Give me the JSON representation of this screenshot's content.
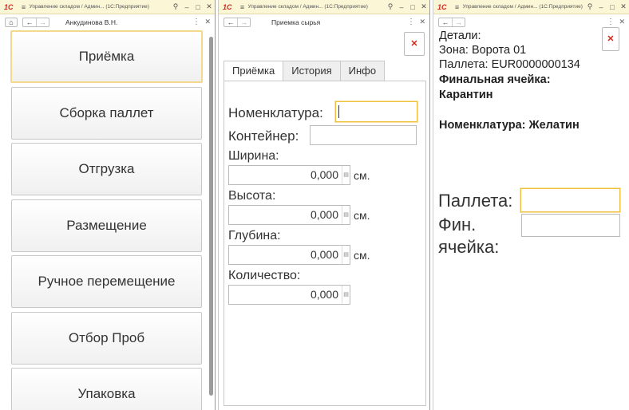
{
  "window1": {
    "title": "Управление складом / Админ...  (1С:Предприятие)",
    "user": "Анкудинова В.Н.",
    "menu": [
      "Приёмка",
      "Сборка паллет",
      "Отгрузка",
      "Размещение",
      "Ручное перемещение",
      "Отбор Проб",
      "Упаковка"
    ]
  },
  "window2": {
    "title": "Управление складом / Админ...  (1С:Предприятие)",
    "form_title": "Приемка сырья",
    "tabs": [
      "Приёмка",
      "История",
      "Инфо"
    ],
    "fields": {
      "nomenclature_label": "Номенклатура:",
      "container_label": "Контейнер:",
      "width_label": "Ширина:",
      "width_value": "0,000",
      "width_unit": "см.",
      "height_label": "Высота:",
      "height_value": "0,000",
      "height_unit": "см.",
      "depth_label": "Глубина:",
      "depth_value": "0,000",
      "depth_unit": "см.",
      "quantity_label": "Количество:",
      "quantity_value": "0,000"
    }
  },
  "window3": {
    "title": "Управление складом / Админ...  (1С:Предприятие)",
    "details_header": "Детали:",
    "zone": "Зона: Ворота 01",
    "pallet": "Паллета: EUR0000000134",
    "final_cell_label": "Финальная ячейка:",
    "final_cell_value": "Карантин",
    "nomenclature": "Номенклатура: Желатин",
    "pallet_input_label": "Паллета:",
    "fin_cell_label_1": "Фин.",
    "fin_cell_label_2": "ячейка:"
  },
  "icons": {
    "logo": "1С",
    "menu_icon": "hamburger-icon",
    "home_icon": "home-icon",
    "back_icon": "arrow-left-icon",
    "forward_icon": "arrow-right-icon",
    "more_icon": "kebab-icon",
    "close_icon": "close-icon"
  },
  "colors": {
    "titlebar": "#fbf6d6",
    "focus_border": "#f0c040",
    "close_red": "#d0261c"
  }
}
